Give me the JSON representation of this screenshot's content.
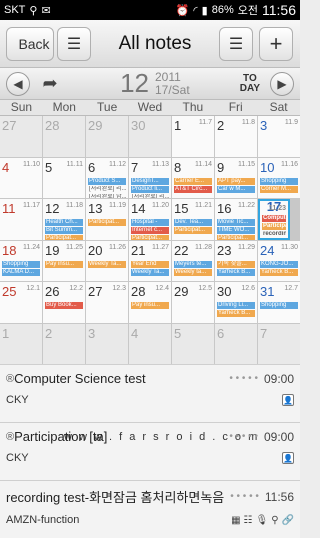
{
  "status": {
    "carrier": "SKT",
    "battery": "86%",
    "am_pm": "오전",
    "time": "11:56"
  },
  "header": {
    "back_label": "Back",
    "title": "All notes"
  },
  "nav": {
    "day": "12",
    "year": "2011",
    "sub": "17/Sat",
    "today_top": "TO",
    "today_bottom": "DAY"
  },
  "weekdays": [
    "Sun",
    "Mon",
    "Tue",
    "Wed",
    "Thu",
    "Fri",
    "Sat"
  ],
  "weeks": [
    [
      {
        "n": "27",
        "l": "",
        "c": "sun prev"
      },
      {
        "n": "28",
        "l": "",
        "c": "prev"
      },
      {
        "n": "29",
        "l": "",
        "c": "prev"
      },
      {
        "n": "30",
        "l": "",
        "c": "prev"
      },
      {
        "n": "1",
        "l": "11.7",
        "c": ""
      },
      {
        "n": "2",
        "l": "11.8",
        "c": ""
      },
      {
        "n": "3",
        "l": "11.9",
        "c": "sat"
      }
    ],
    [
      {
        "n": "4",
        "l": "11.10",
        "c": "sun"
      },
      {
        "n": "5",
        "l": "11.11",
        "c": ""
      },
      {
        "n": "6",
        "l": "11.12",
        "c": ""
      },
      {
        "n": "7",
        "l": "11.13",
        "c": ""
      },
      {
        "n": "8",
        "l": "11.14",
        "c": ""
      },
      {
        "n": "9",
        "l": "11.15",
        "c": ""
      },
      {
        "n": "10",
        "l": "11.16",
        "c": "sat"
      }
    ],
    [
      {
        "n": "11",
        "l": "11.17",
        "c": "sun"
      },
      {
        "n": "12",
        "l": "11.18",
        "c": ""
      },
      {
        "n": "13",
        "l": "11.19",
        "c": ""
      },
      {
        "n": "14",
        "l": "11.20",
        "c": ""
      },
      {
        "n": "15",
        "l": "11.21",
        "c": ""
      },
      {
        "n": "16",
        "l": "11.22",
        "c": ""
      },
      {
        "n": "17",
        "l": "11.23",
        "c": "sat"
      }
    ],
    [
      {
        "n": "18",
        "l": "11.24",
        "c": "sun"
      },
      {
        "n": "19",
        "l": "11.25",
        "c": ""
      },
      {
        "n": "20",
        "l": "11.26",
        "c": ""
      },
      {
        "n": "21",
        "l": "11.27",
        "c": ""
      },
      {
        "n": "22",
        "l": "11.28",
        "c": ""
      },
      {
        "n": "23",
        "l": "11.29",
        "c": ""
      },
      {
        "n": "24",
        "l": "11.30",
        "c": "sat"
      }
    ],
    [
      {
        "n": "25",
        "l": "12.1",
        "c": "sun"
      },
      {
        "n": "26",
        "l": "12.2",
        "c": ""
      },
      {
        "n": "27",
        "l": "12.3",
        "c": ""
      },
      {
        "n": "28",
        "l": "12.4",
        "c": ""
      },
      {
        "n": "29",
        "l": "12.5",
        "c": ""
      },
      {
        "n": "30",
        "l": "12.6",
        "c": ""
      },
      {
        "n": "31",
        "l": "12.7",
        "c": "sat"
      }
    ],
    [
      {
        "n": "1",
        "l": "",
        "c": "sun prev"
      },
      {
        "n": "2",
        "l": "",
        "c": "prev"
      },
      {
        "n": "3",
        "l": "",
        "c": "prev"
      },
      {
        "n": "4",
        "l": "",
        "c": "prev"
      },
      {
        "n": "5",
        "l": "",
        "c": "prev"
      },
      {
        "n": "6",
        "l": "",
        "c": "prev"
      },
      {
        "n": "7",
        "l": "",
        "c": "sat prev"
      }
    ]
  ],
  "events": {
    "1-2": [
      [
        "blue",
        "Product S..."
      ],
      [
        "plain",
        "[처리완료] 리..."
      ],
      [
        "plain",
        "[처리완료] 남..."
      ]
    ],
    "1-3": [
      [
        "blue",
        "DesignT..."
      ],
      [
        "blue",
        "Product li..."
      ],
      [
        "plain",
        "[처리완료] 리..."
      ]
    ],
    "1-4": [
      [
        "orange",
        "Carrier E..."
      ],
      [
        "red",
        "AT&T Circ..."
      ]
    ],
    "1-5": [
      [
        "orange",
        "APT pay..."
      ],
      [
        "blue",
        "Car w M..."
      ]
    ],
    "1-6": [
      [
        "blue",
        "Shopping"
      ],
      [
        "orange",
        "Corner M..."
      ]
    ],
    "2-1": [
      [
        "blue",
        "Health Ch..."
      ],
      [
        "blue",
        "Bit Summ..."
      ],
      [
        "orange",
        "Participat..."
      ]
    ],
    "2-2": [
      [
        "orange",
        "Participat..."
      ]
    ],
    "2-3": [
      [
        "blue",
        "Hospital -"
      ],
      [
        "red",
        "Internet c..."
      ],
      [
        "orange",
        "Participat..."
      ]
    ],
    "2-4": [
      [
        "blue",
        "Dev. Tea..."
      ],
      [
        "orange",
        "Participat..."
      ]
    ],
    "2-5": [
      [
        "blue",
        "Movie Tic..."
      ],
      [
        "blue",
        "TIME WO..."
      ],
      [
        "orange",
        "Participat..."
      ]
    ],
    "2-6": [
      [
        "red",
        "Computer"
      ],
      [
        "orange",
        "Participat..."
      ],
      [
        "plain",
        "recording te..."
      ]
    ],
    "3-0": [
      [
        "blue",
        "Shopping"
      ],
      [
        "blue",
        "KALMA D..."
      ]
    ],
    "3-1": [
      [
        "orange",
        "Pay insu..."
      ]
    ],
    "3-2": [
      [
        "orange",
        "Weekly Ta..."
      ]
    ],
    "3-3": [
      [
        "orange",
        "Year End"
      ],
      [
        "blue",
        "Weekly Ta..."
      ]
    ],
    "3-4": [
      [
        "blue",
        "Meyers te..."
      ],
      [
        "orange",
        "Weekly ta..."
      ]
    ],
    "3-5": [
      [
        "orange",
        "기록 찾을..."
      ],
      [
        "blue",
        "Yarheck B..."
      ]
    ],
    "3-6": [
      [
        "blue",
        "KONG-JO..."
      ],
      [
        "orange",
        "Yarheck B..."
      ]
    ],
    "4-1": [
      [
        "red",
        "Buy Book..."
      ]
    ],
    "4-3": [
      [
        "orange",
        "Pay insu..."
      ]
    ],
    "4-5": [
      [
        "blue",
        "Driving Li..."
      ],
      [
        "orange",
        "Yarheck B..."
      ]
    ],
    "4-6": [
      [
        "blue",
        "Shopping"
      ]
    ]
  },
  "notes": [
    {
      "title": "Computer Science test",
      "time": "09:00",
      "owner": "CKY"
    },
    {
      "title": "Participation [ta]",
      "time": "09:00",
      "owner": "CKY"
    },
    {
      "title": "recording test-화면잠금 홈처리하면녹음/...",
      "time": "11:56",
      "owner": "AMZN-function"
    }
  ],
  "watermark": "w w w . f a r s r o i d . c o m"
}
